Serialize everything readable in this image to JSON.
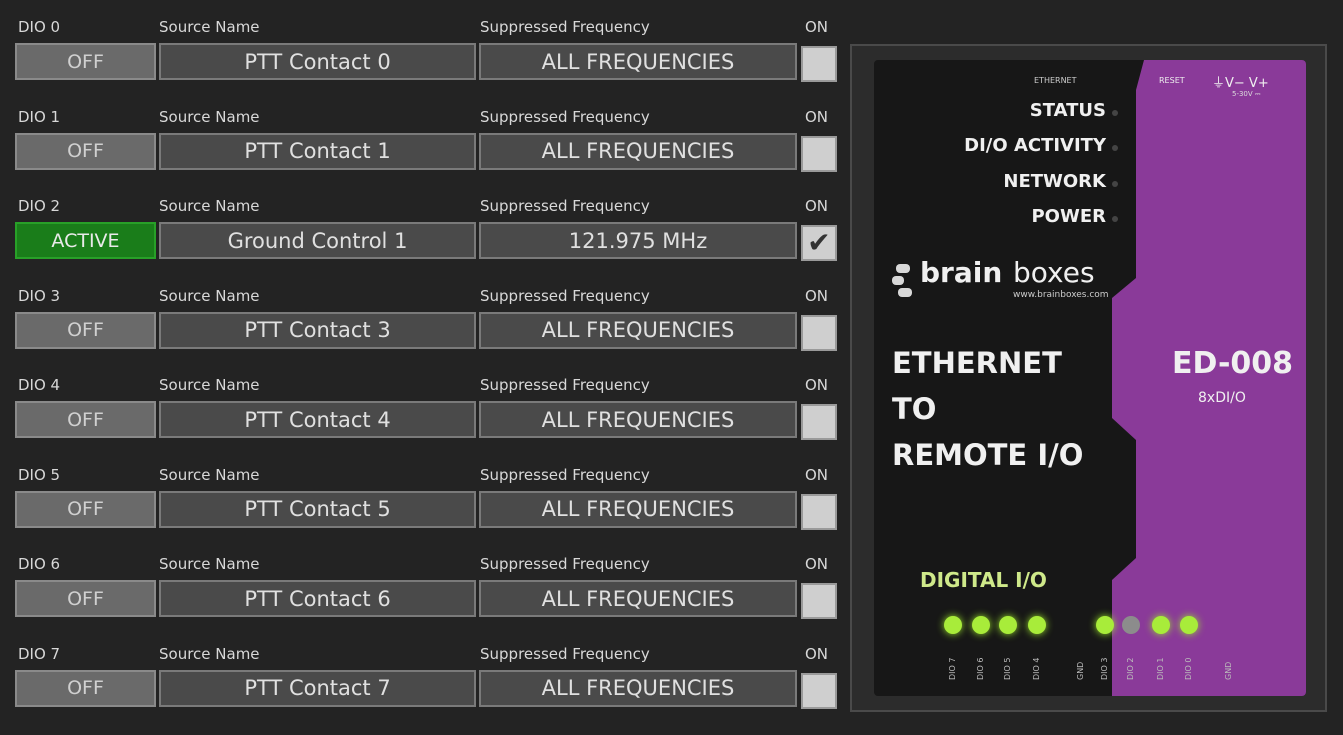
{
  "labels": {
    "dio_prefix_list": [
      "DIO 0",
      "DIO 1",
      "DIO 2",
      "DIO 3",
      "DIO 4",
      "DIO 5",
      "DIO 6",
      "DIO 7"
    ],
    "source_name": "Source Name",
    "suppressed_frequency": "Suppressed Frequency",
    "on": "ON"
  },
  "rows": [
    {
      "dio": "DIO 0",
      "state": "OFF",
      "active": false,
      "source": "PTT Contact 0",
      "frequency": "ALL FREQUENCIES",
      "checked": false
    },
    {
      "dio": "DIO 1",
      "state": "OFF",
      "active": false,
      "source": "PTT Contact 1",
      "frequency": "ALL FREQUENCIES",
      "checked": false
    },
    {
      "dio": "DIO 2",
      "state": "ACTIVE",
      "active": true,
      "source": "Ground Control 1",
      "frequency": "121.975 MHz",
      "checked": true
    },
    {
      "dio": "DIO 3",
      "state": "OFF",
      "active": false,
      "source": "PTT Contact 3",
      "frequency": "ALL FREQUENCIES",
      "checked": false
    },
    {
      "dio": "DIO 4",
      "state": "OFF",
      "active": false,
      "source": "PTT Contact 4",
      "frequency": "ALL FREQUENCIES",
      "checked": false
    },
    {
      "dio": "DIO 5",
      "state": "OFF",
      "active": false,
      "source": "PTT Contact 5",
      "frequency": "ALL FREQUENCIES",
      "checked": false
    },
    {
      "dio": "DIO 6",
      "state": "OFF",
      "active": false,
      "source": "PTT Contact 6",
      "frequency": "ALL FREQUENCIES",
      "checked": false
    },
    {
      "dio": "DIO 7",
      "state": "OFF",
      "active": false,
      "source": "PTT Contact 7",
      "frequency": "ALL FREQUENCIES",
      "checked": false
    }
  ],
  "device": {
    "ethernet_small": "ETHERNET",
    "reset": "RESET",
    "power_terminals": "V−  V+",
    "voltage": "5-30V ⎓",
    "status_labels": [
      "STATUS",
      "DI/O ACTIVITY",
      "NETWORK",
      "POWER"
    ],
    "brand_bold": "brain",
    "brand_light": "boxes",
    "brand_url": "www.brainboxes.com",
    "headline": [
      "ETHERNET",
      "TO",
      "REMOTE I/O"
    ],
    "model": "ED-008",
    "model_sub": "8xDI/O",
    "digital_io": "DIGITAL I/O",
    "leds": [
      {
        "pin": "DIO 7",
        "on": true
      },
      {
        "pin": "DIO 6",
        "on": true
      },
      {
        "pin": "DIO 5",
        "on": true
      },
      {
        "pin": "DIO 4",
        "on": true
      },
      {
        "pin": "DIO 3",
        "on": true
      },
      {
        "pin": "DIO 2",
        "on": false
      },
      {
        "pin": "DIO 1",
        "on": true
      },
      {
        "pin": "DIO 0",
        "on": true
      }
    ],
    "gnd": "GND",
    "colors": {
      "panel": "#8a3a99",
      "led_on": "#a8ec3a",
      "active": "#1a7d1a"
    }
  }
}
